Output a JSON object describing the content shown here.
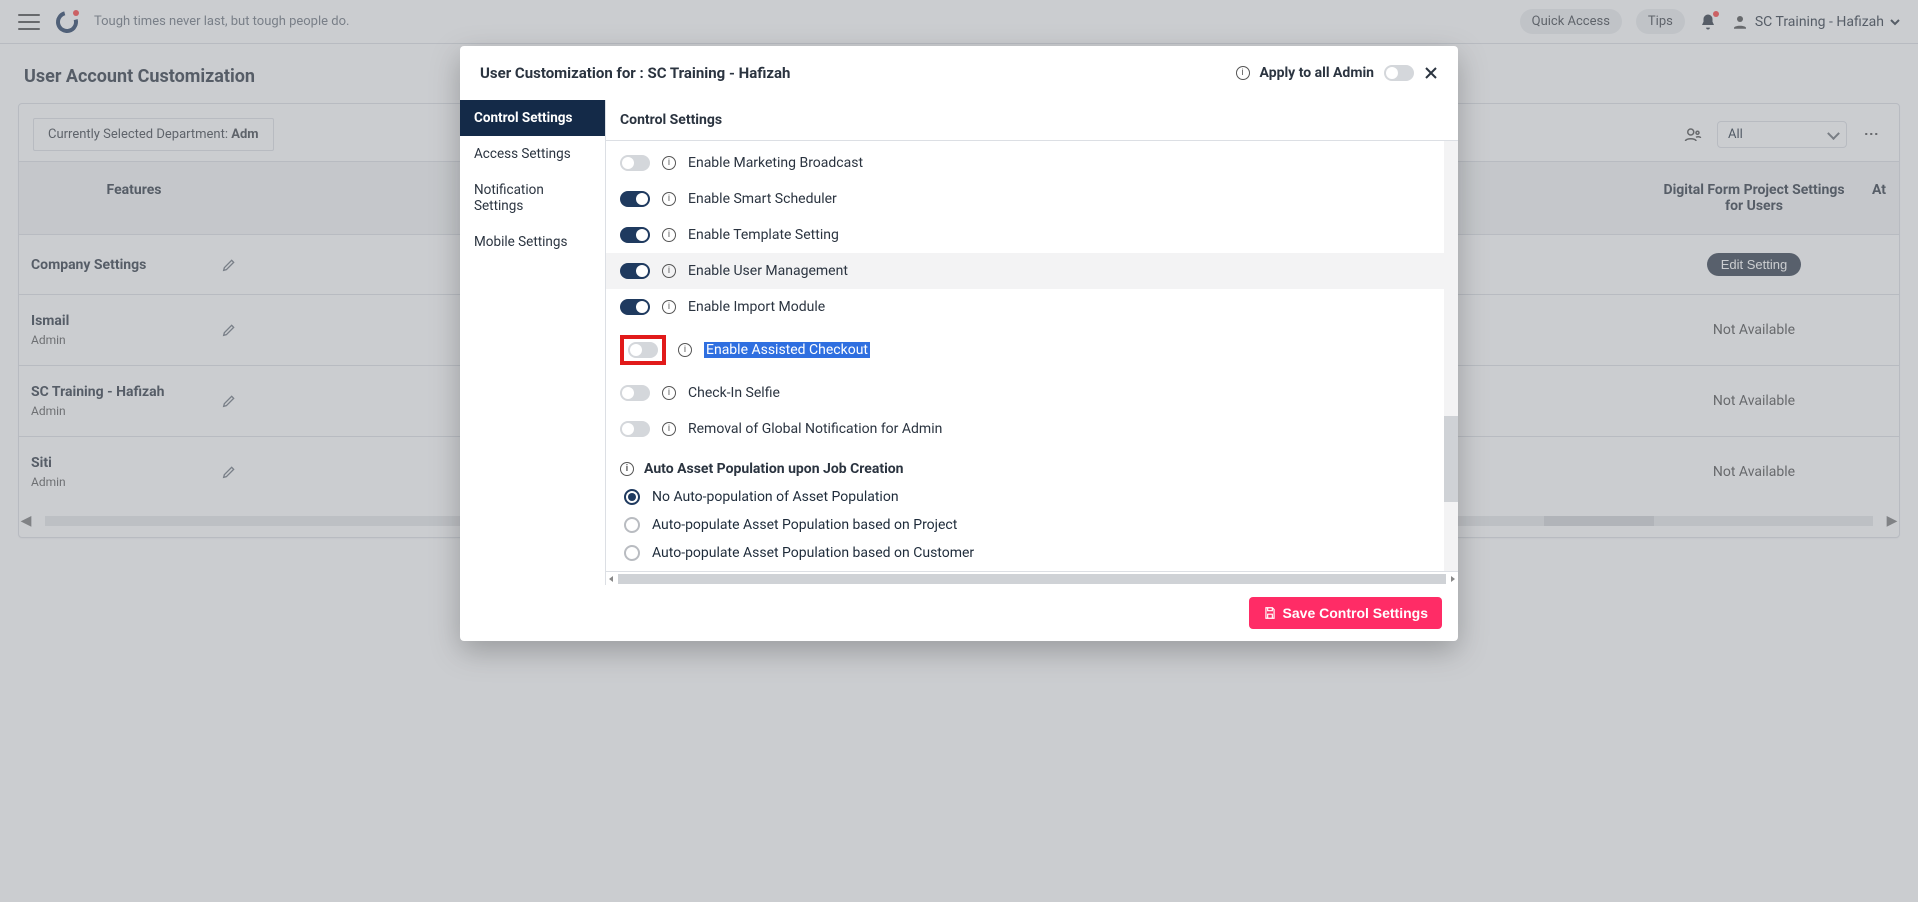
{
  "topbar": {
    "tagline": "Tough times never last, but tough people do.",
    "quick_access": "Quick Access",
    "tips": "Tips",
    "user_name": "SC Training - Hafizah"
  },
  "page_title": "User Account Customization",
  "filters": {
    "dept_prefix": "Currently Selected Department: ",
    "dept_value": "Adm",
    "role_selected": "All"
  },
  "grid": {
    "headers": {
      "features": "Features",
      "digital_form": "Digital Form Project Settings for Users",
      "at": "At"
    },
    "rows": [
      {
        "name": "Company Settings",
        "role": null,
        "action_type": "edit",
        "action_label": "Edit Setting"
      },
      {
        "name": "Ismail",
        "role": "Admin",
        "action_type": "na",
        "action_label": "Not Available"
      },
      {
        "name": "SC Training - Hafizah",
        "role": "Admin",
        "action_type": "na",
        "action_label": "Not Available"
      },
      {
        "name": "Siti",
        "role": "Admin",
        "action_type": "na",
        "action_label": "Not Available"
      }
    ]
  },
  "modal": {
    "title_prefix": "User Customization for : ",
    "title_user": "SC Training - Hafizah",
    "apply_label": "Apply to all Admin",
    "save_label": "Save Control Settings",
    "tabs": [
      {
        "label": "Control Settings",
        "active": true
      },
      {
        "label": "Access Settings",
        "active": false
      },
      {
        "label": "Notification Settings",
        "active": false
      },
      {
        "label": "Mobile Settings",
        "active": false
      }
    ],
    "pane_header": "Control Settings",
    "options": [
      {
        "label": "Enable Marketing Broadcast",
        "on": false
      },
      {
        "label": "Enable Smart Scheduler",
        "on": true
      },
      {
        "label": "Enable Template Setting",
        "on": true
      },
      {
        "label": "Enable User Management",
        "on": true,
        "rowHighlight": true
      },
      {
        "label": "Enable Import Module",
        "on": true
      },
      {
        "label": "Enable Assisted Checkout",
        "on": false,
        "selHighlight": true,
        "redBox": true
      },
      {
        "label": "Check-In Selfie",
        "on": false
      },
      {
        "label": "Removal of Global Notification for Admin",
        "on": false
      }
    ],
    "asset_section_label": "Auto Asset Population upon Job Creation",
    "radios": [
      {
        "label": "No Auto-population of Asset Population",
        "checked": true
      },
      {
        "label": "Auto-populate Asset Population based on Project",
        "checked": false
      },
      {
        "label": "Auto-populate Asset Population based on Customer",
        "checked": false
      }
    ]
  }
}
